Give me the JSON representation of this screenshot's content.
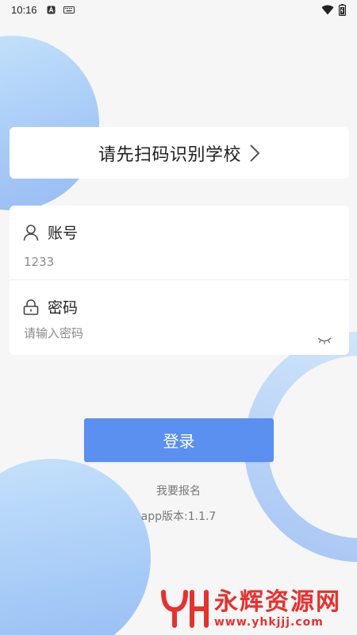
{
  "status_bar": {
    "time": "10:16",
    "icons": [
      "a-icon",
      "keyboard-icon",
      "wifi-icon",
      "battery-icon"
    ]
  },
  "school": {
    "label": "请先扫码识别学校",
    "chevron_icon": "chevron-right-icon"
  },
  "form": {
    "account": {
      "label": "账号",
      "value": "1233",
      "icon": "user-icon"
    },
    "password": {
      "label": "密码",
      "placeholder": "请输入密码",
      "icon": "lock-icon",
      "toggle_icon": "eye-closed-icon"
    }
  },
  "login": {
    "label": "登录"
  },
  "register": {
    "label": "我要报名"
  },
  "version": {
    "label": "app版本:1.1.7"
  },
  "watermark": {
    "text": "永辉资源网",
    "url": "www.yhkjjj.com"
  },
  "colors": {
    "accent": "#5b8ff0",
    "background": "#f6f6f7",
    "decor_blue": "#a9cdf7",
    "watermark_red": "#e5322e"
  }
}
